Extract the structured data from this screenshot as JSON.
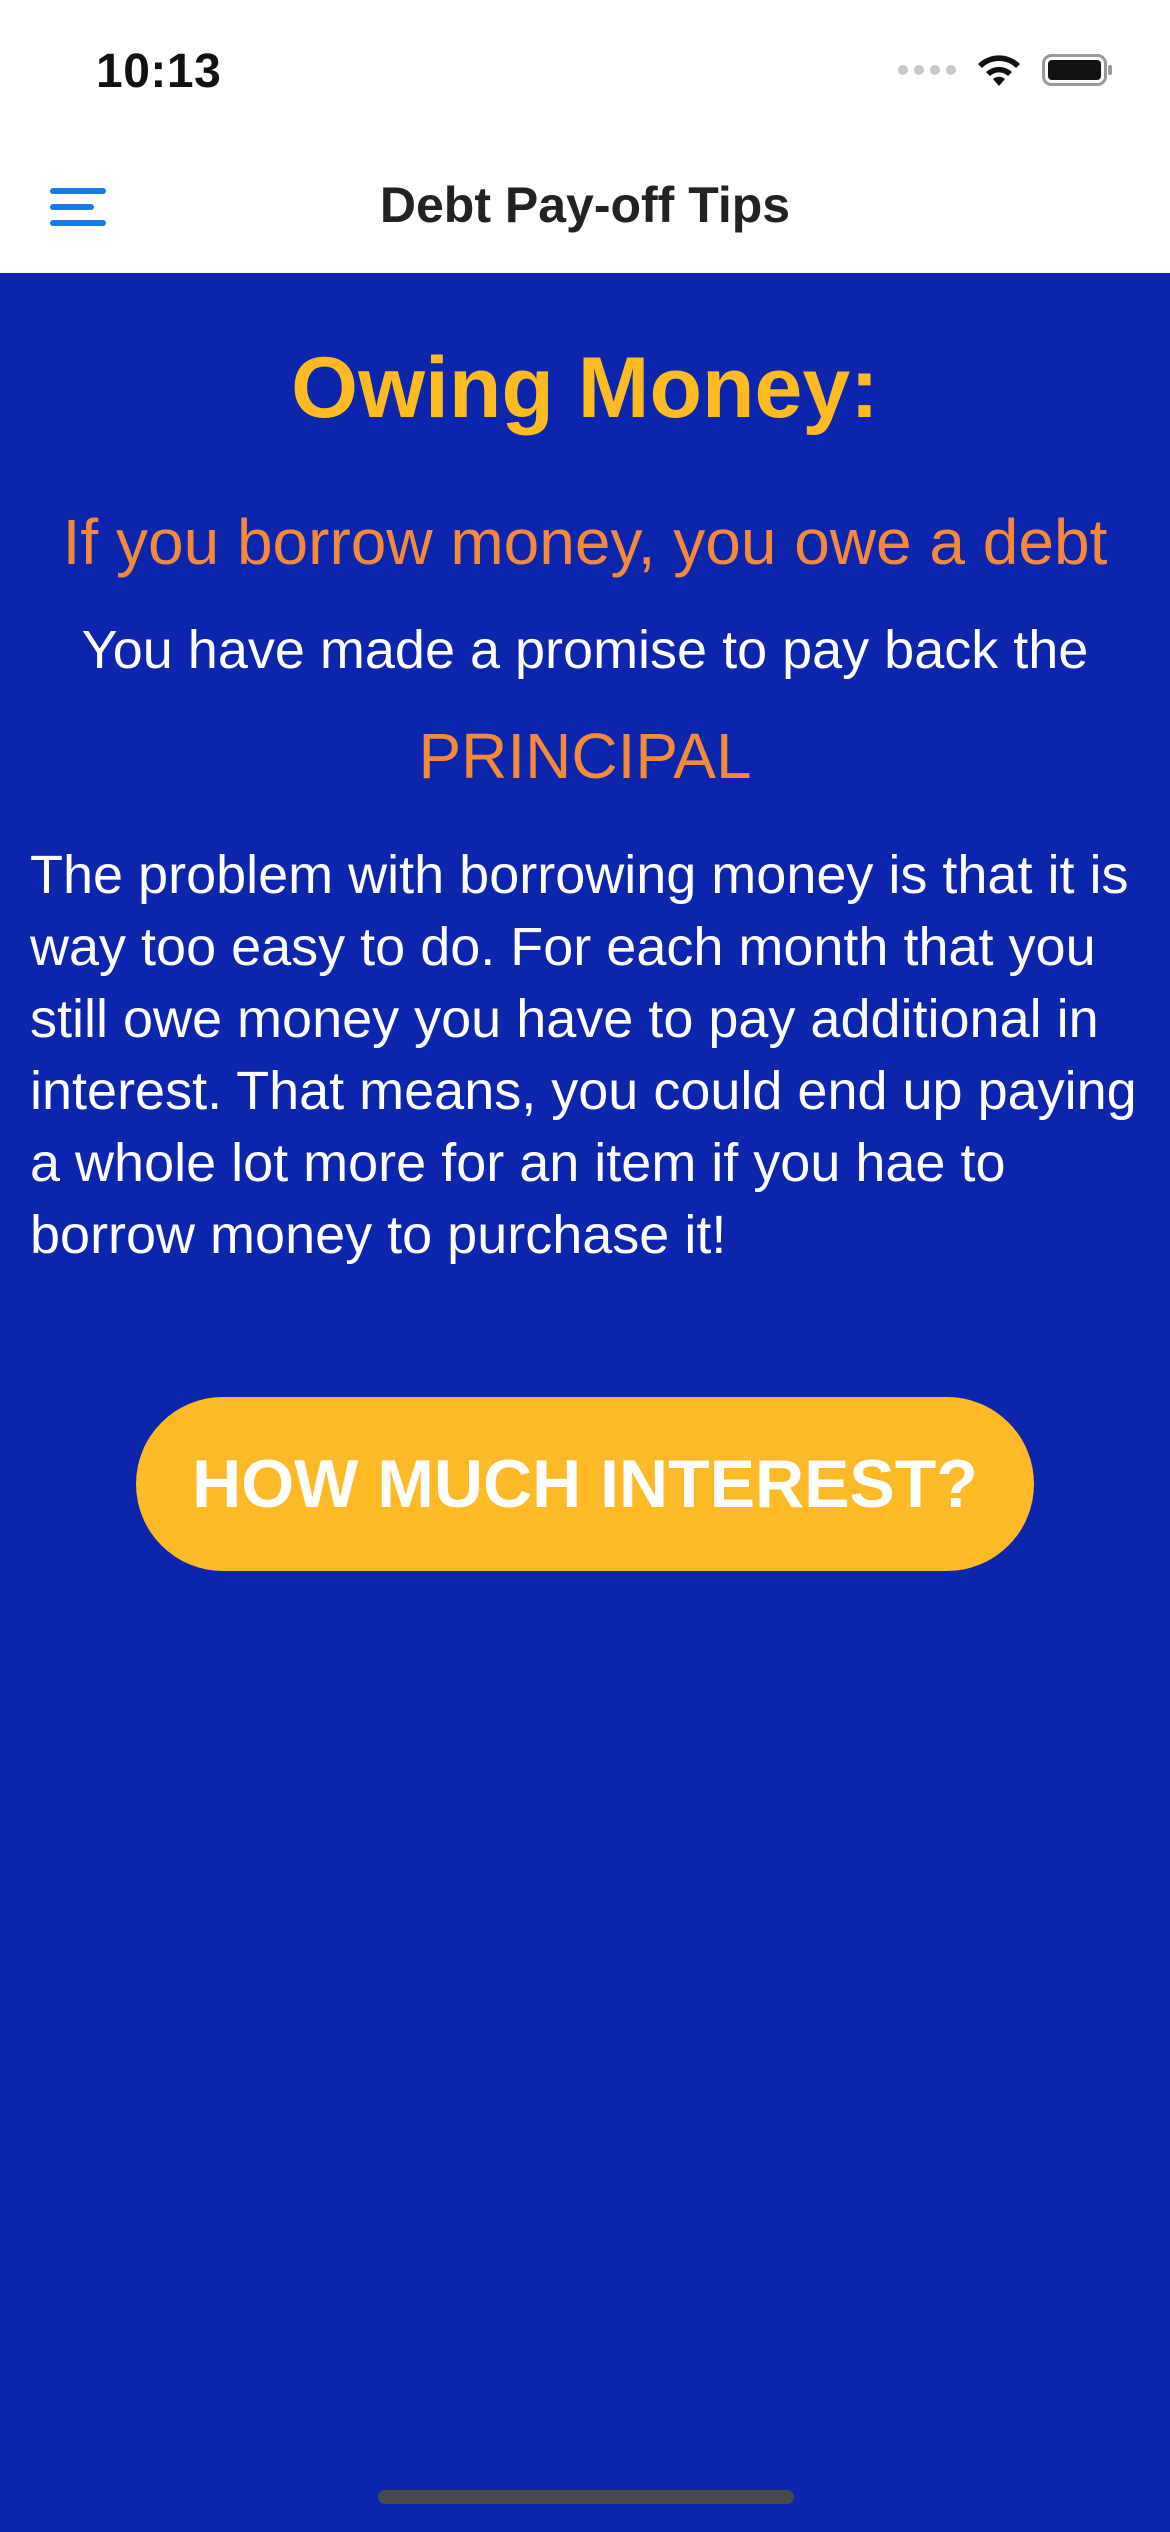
{
  "status_bar": {
    "time": "10:13",
    "icons": [
      "cellular-signal-icon",
      "wifi-icon",
      "battery-icon"
    ]
  },
  "nav": {
    "menu_icon": "hamburger-menu-icon",
    "title": "Debt Pay-off Tips"
  },
  "content": {
    "heading": "Owing Money:",
    "subheading": "If you borrow money, you owe a debt",
    "promise": "You have made a promise to pay back the",
    "principal": "PRINCIPAL",
    "body": "The problem with borrowing money is that it is way too easy to do. For each month that you still owe money you have to pay additional in interest. That means, you could end up paying a whole lot more for an item if you hae to borrow money to purchase it!",
    "button_label": "HOW MUCH INTEREST?"
  },
  "colors": {
    "background": "#0B25AD",
    "heading": "#FFBA22",
    "accent_orange": "#F5893A",
    "button": "#FDB926",
    "menu_icon": "#1A7BE8"
  }
}
